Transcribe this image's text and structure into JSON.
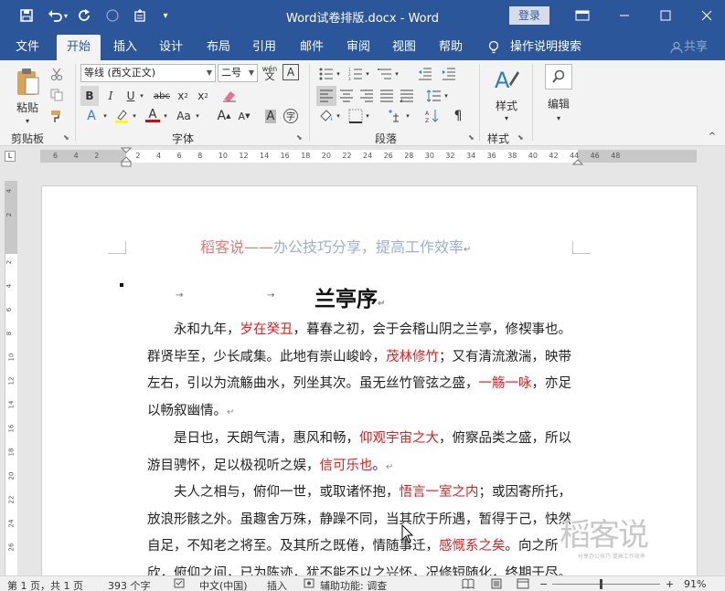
{
  "title_bar": {
    "document_title": "Word试卷排版.docx  -  Word",
    "login_label": "登录",
    "quick_access": [
      "save-icon",
      "undo-icon",
      "redo-icon",
      "touch-mode-icon",
      "new-doc-icon",
      "customize-icon"
    ]
  },
  "tabs": [
    {
      "label": "文件"
    },
    {
      "label": "开始"
    },
    {
      "label": "插入"
    },
    {
      "label": "设计"
    },
    {
      "label": "布局"
    },
    {
      "label": "引用"
    },
    {
      "label": "邮件"
    },
    {
      "label": "审阅"
    },
    {
      "label": "视图"
    },
    {
      "label": "帮助"
    }
  ],
  "tell_me": "操作说明搜索",
  "share_label": "共享",
  "ribbon": {
    "clipboard": {
      "paste_label": "粘贴",
      "group_label": "剪贴板"
    },
    "font": {
      "font_name": "等线 (西文正文)",
      "font_size": "二号",
      "phonetic_label": "wén",
      "border_char": "A",
      "bold": "B",
      "italic": "I",
      "underline": "U",
      "strike": "abc",
      "subscript": "x",
      "superscript": "x",
      "case_label": "Aa",
      "grow": "A",
      "shrink": "A",
      "group_label": "字体"
    },
    "paragraph": {
      "group_label": "段落"
    },
    "styles": {
      "label": "样式",
      "group_label": "样式"
    },
    "editing": {
      "label": "编辑"
    }
  },
  "ruler_numbers": [
    "6",
    "4",
    "2",
    "2",
    "4",
    "6",
    "8",
    "10",
    "12",
    "14",
    "16",
    "18",
    "20",
    "22",
    "24",
    "26",
    "28",
    "30",
    "32",
    "34",
    "36",
    "38",
    "40",
    "42",
    "44",
    "46",
    "48"
  ],
  "vruler_numbers": [
    "4",
    "2",
    "2",
    "4",
    "6",
    "8",
    "10",
    "12",
    "14",
    "16",
    "18",
    "20",
    "22",
    "24",
    "26"
  ],
  "document": {
    "header_red": "稻客说——",
    "header_blue": "办公技巧分享，提高工作效率",
    "title": "兰亭序",
    "paragraphs": [
      [
        {
          "t": "永和九年，",
          "red": false
        },
        {
          "t": "岁在癸丑",
          "red": true
        },
        {
          "t": "，暮春之初，会于会稽山阴之兰亭，修禊事也。群贤毕至，少长咸集。此地有崇山峻岭，",
          "red": false
        },
        {
          "t": "茂林修竹",
          "red": true
        },
        {
          "t": "；又有清流激湍，映带左右，引以为流觞曲水，列坐其次。虽无丝竹管弦之盛，",
          "red": false
        },
        {
          "t": "一觞一咏",
          "red": true
        },
        {
          "t": "，亦足以畅叙幽情。",
          "red": false
        }
      ],
      [
        {
          "t": "是日也，天朗气清，惠风和畅，",
          "red": false
        },
        {
          "t": "仰观宇宙之大",
          "red": true
        },
        {
          "t": "，俯察品类之盛，所以游目骋怀，足以极视听之娱，",
          "red": false
        },
        {
          "t": "信可乐也",
          "red": true
        },
        {
          "t": "。",
          "red": false
        }
      ],
      [
        {
          "t": "夫人之相与，俯仰一世，或取诸怀抱，",
          "red": false
        },
        {
          "t": "悟言一室之内",
          "red": true
        },
        {
          "t": "；或因寄所托，放浪形骸之外。虽趣舍万殊，静躁不同，当其欣于所遇，暂得于己，快然自足，不知老之将至。及其所之既倦，情随事迁，",
          "red": false
        },
        {
          "t": "感慨系之矣",
          "red": true
        },
        {
          "t": "。向之所欣，俯仰之间，已为陈迹，犹不能不以之兴怀，况修短随化，终期于尽。古人云：",
          "red": false
        }
      ]
    ]
  },
  "watermark": {
    "text": "稻客说",
    "sub": "分享办公技巧  提高工作效率"
  },
  "status_bar": {
    "page": "第 1 页，共 1 页",
    "words": "393 个字",
    "language": "中文(中国)",
    "mode": "插入",
    "accessibility": "辅助功能: 调查",
    "zoom": "91%"
  }
}
